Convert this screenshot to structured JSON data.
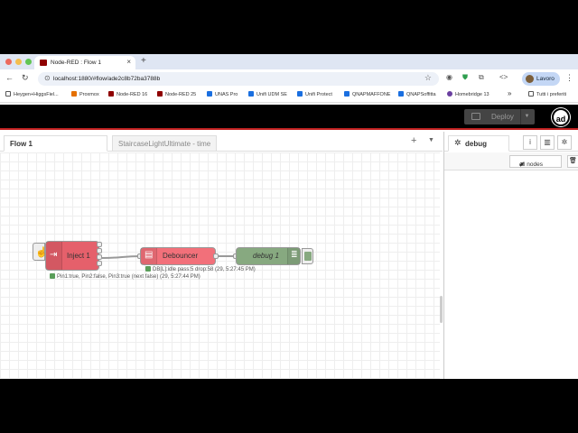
{
  "browser": {
    "tab_title": "Node-RED : Flow 1",
    "url": "localhost:1880/#flow/ade2c8b72ba3788b",
    "profile_label": "Lavoro",
    "bookmarks": [
      {
        "label": "Heygen+HiggsFiel...",
        "color": "#333333"
      },
      {
        "label": "Proxmox",
        "color": "#e57000"
      },
      {
        "label": "Node-RED 16",
        "color": "#8f0000"
      },
      {
        "label": "Node-RED 25",
        "color": "#8f0000"
      },
      {
        "label": "UNAS Pro",
        "color": "#1a6fe0"
      },
      {
        "label": "Unifi UDM SE",
        "color": "#1a6fe0"
      },
      {
        "label": "Unifi Protect",
        "color": "#1a6fe0"
      },
      {
        "label": "QNAPMAFFONE",
        "color": "#1a6fe0"
      },
      {
        "label": "QNAPSoffitta",
        "color": "#1a6fe0"
      },
      {
        "label": "Homebridge 13",
        "color": "#6a3fa0"
      }
    ],
    "more_bookmarks": "»",
    "all_bookmarks_label": "Tutti i preferiti"
  },
  "header": {
    "deploy_label": "Deploy",
    "user_initials": "ad"
  },
  "workspace": {
    "tabs": [
      {
        "label": "Flow 1",
        "active": true
      },
      {
        "label": "StaircaseLightUltimate - time",
        "active": false
      }
    ],
    "add_label": "+",
    "menu_label": "▼"
  },
  "flow": {
    "nodes": {
      "inject": {
        "label": "Inject 1",
        "color": "#e5606b"
      },
      "debouncer": {
        "label": "Debouncer",
        "color": "#f2707a"
      },
      "debug": {
        "label": "debug 1",
        "color": "#87a980"
      }
    },
    "status": {
      "inject": "Pin1:true, Pin2:false, Pin3:true (next false) (29, 5:27:44 PM)",
      "debouncer": "DB[L]:idle pass:5 drop:58 (29, 5:27:45 PM)"
    }
  },
  "sidebar": {
    "active_tab": "debug",
    "filter_label": "all nodes"
  }
}
